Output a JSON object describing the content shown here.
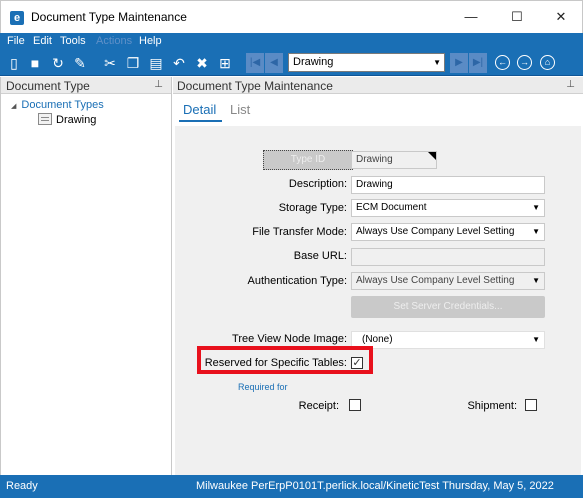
{
  "window": {
    "logo_letter": "e",
    "title": "Document Type Maintenance",
    "minimize": "—",
    "maximize": "☐",
    "close": "✕"
  },
  "menu": [
    {
      "label": "File",
      "enabled": true
    },
    {
      "label": "Edit",
      "enabled": true
    },
    {
      "label": "Tools",
      "enabled": true
    },
    {
      "label": "Actions",
      "enabled": false
    },
    {
      "label": "Help",
      "enabled": true
    }
  ],
  "toolbar": {
    "icons": [
      "new-icon",
      "save-icon",
      "refresh-icon",
      "clear-icon",
      "cut-icon",
      "copy-icon",
      "paste-icon",
      "undo-icon",
      "delete-icon",
      "search-icon"
    ],
    "record_select_value": "Drawing",
    "nav_icons": [
      "first-record-icon",
      "previous-record-icon",
      "next-record-icon",
      "last-record-icon"
    ],
    "circle_icons": [
      "back-icon",
      "forward-icon",
      "home-icon"
    ]
  },
  "left_pane": {
    "header": "Document Type",
    "tree": {
      "root": "Document Types",
      "children": [
        "Drawing"
      ]
    }
  },
  "right_pane": {
    "header": "Document Type Maintenance",
    "tabs": [
      {
        "label": "Detail",
        "active": true
      },
      {
        "label": "List",
        "active": false
      }
    ]
  },
  "form": {
    "type_id_button": "Type ID",
    "type_id_value": "Drawing",
    "description_label": "Description:",
    "description_value": "Drawing",
    "storage_type_label": "Storage Type:",
    "storage_type_value": "ECM Document",
    "file_transfer_label": "File Transfer Mode:",
    "file_transfer_value": "Always Use Company Level Setting",
    "base_url_label": "Base URL:",
    "base_url_value": "",
    "auth_type_label": "Authentication Type:",
    "auth_type_value": "Always Use Company Level Setting",
    "set_credentials_button": "Set Server Credentials...",
    "tree_view_label": "Tree View Node Image:",
    "tree_view_value": "(None)",
    "reserved_label": "Reserved for Specific Tables:",
    "reserved_checked": true,
    "required_for": "Required for",
    "receipt_label": "Receipt:",
    "receipt_checked": false,
    "shipment_label": "Shipment:",
    "shipment_checked": false
  },
  "status": {
    "ready": "Ready",
    "info": "Milwaukee  PerErpP0101T.perlick.local/KineticTest  Thursday, May 5, 2022"
  },
  "colors": {
    "brand": "#1a6fb5",
    "highlight": "#e8101c",
    "form_bg": "#f0f0f0"
  }
}
